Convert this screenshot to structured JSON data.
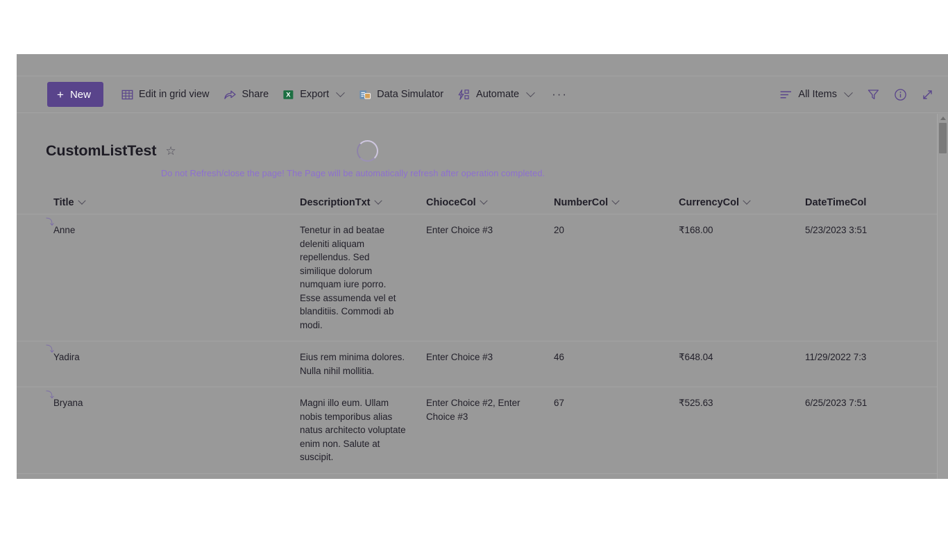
{
  "toolbar": {
    "new_label": "New",
    "new_plus": "+",
    "edit_grid_label": "Edit in grid view",
    "share_label": "Share",
    "export_label": "Export",
    "data_simulator_label": "Data Simulator",
    "automate_label": "Automate",
    "overflow_label": "···",
    "view_label": "All Items",
    "filter_name": "filter-icon",
    "info_name": "info-icon",
    "expand_name": "expand-icon",
    "accent_color": "#59448b"
  },
  "list": {
    "title": "CustomListTest",
    "favorite_glyph": "☆",
    "warning": "Do not Refresh/close the page! The Page will be automatically refresh after operation completed.",
    "warning_color": "#8d6fd0",
    "loading": true
  },
  "grid": {
    "columns": [
      {
        "label": "Title"
      },
      {
        "label": "DescriptionTxt"
      },
      {
        "label": "ChioceCol"
      },
      {
        "label": "NumberCol"
      },
      {
        "label": "CurrencyCol"
      },
      {
        "label": "DateTimeCol"
      }
    ],
    "rows": [
      {
        "title": "Anne",
        "description": "Tenetur in ad beatae deleniti aliquam repellendus. Sed similique dolorum numquam iure porro. Esse assumenda vel et blanditiis. Commodi ab modi.",
        "choice": "Enter Choice #3",
        "number": "20",
        "currency": "₹168.00",
        "datetime": "5/23/2023 3:51",
        "new_mark": "⤵"
      },
      {
        "title": "Yadira",
        "description": "Eius rem minima dolores. Nulla nihil mollitia.",
        "choice": "Enter Choice #3",
        "number": "46",
        "currency": "₹648.04",
        "datetime": "11/29/2022 7:3",
        "new_mark": "⤵"
      },
      {
        "title": "Bryana",
        "description": "Magni illo eum. Ullam nobis temporibus alias natus architecto voluptate enim non. Salute at suscipit.",
        "choice": "Enter Choice #2, Enter Choice #3",
        "number": "67",
        "currency": "₹525.63",
        "datetime": "6/25/2023 7:51",
        "new_mark": "⤵"
      }
    ]
  }
}
